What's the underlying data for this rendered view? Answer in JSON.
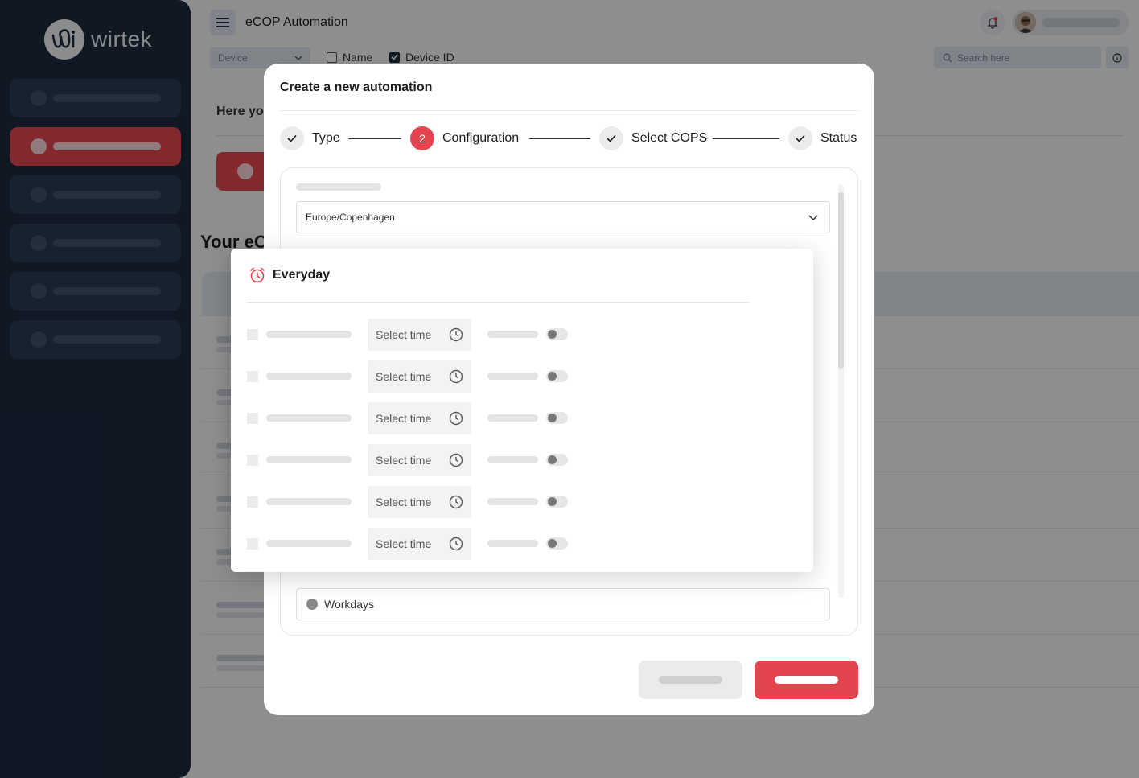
{
  "app": {
    "brand": "wirtek",
    "title": "eCOP Automation"
  },
  "filters": {
    "select_value": "Device",
    "name_label": "Name",
    "name_checked": false,
    "device_id_label": "Device ID",
    "device_id_checked": true,
    "search_placeholder": "Search here"
  },
  "background": {
    "here_text": "Here you",
    "your_heading": "Your eC"
  },
  "modal": {
    "title": "Create a new automation",
    "steps": [
      {
        "label": "Type",
        "state": "done"
      },
      {
        "label": "Configuration",
        "state": "current",
        "number": "2"
      },
      {
        "label": "Select COPS",
        "state": "done"
      },
      {
        "label": "Status",
        "state": "done"
      }
    ],
    "timezone_value": "Europe/Copenhagen",
    "workdays_label": "Workdays"
  },
  "popup": {
    "title": "Everyday",
    "time_placeholder": "Select time",
    "rows": [
      {
        "time": "Select time"
      },
      {
        "time": "Select time"
      },
      {
        "time": "Select time"
      },
      {
        "time": "Select time"
      },
      {
        "time": "Select time"
      },
      {
        "time": "Select time"
      }
    ]
  },
  "colors": {
    "accent": "#e2454e",
    "sidebar": "#1c2a3f"
  }
}
